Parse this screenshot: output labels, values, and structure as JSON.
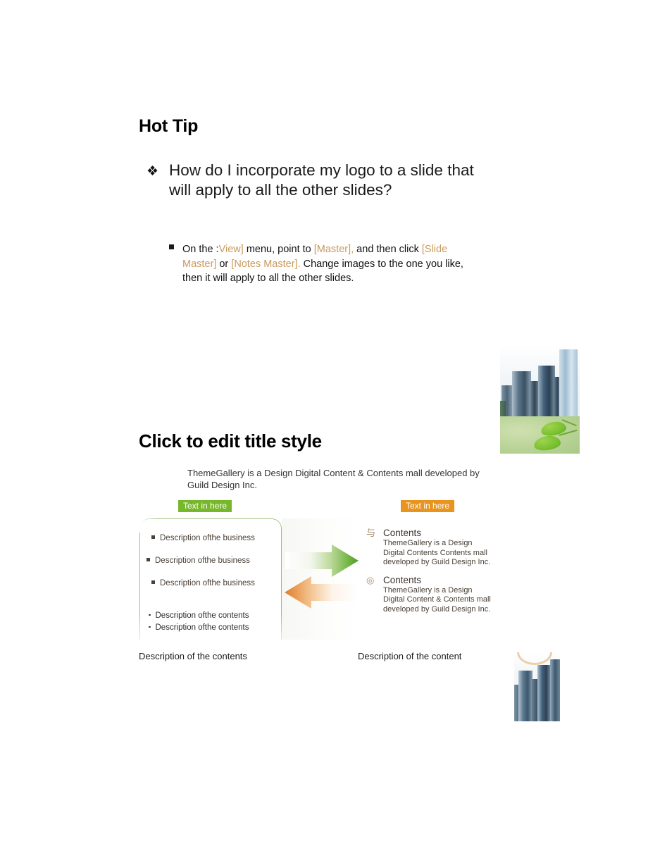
{
  "slide_hot_tip": {
    "title": "Hot Tip",
    "bullet_marker": "❖",
    "bullet_text": "How do I incorporate my logo to a slide that will apply to all the other slides?",
    "sub_bullet": {
      "marker": "square-bullet",
      "segments": [
        {
          "text": "On the :",
          "highlight": false
        },
        {
          "text": "View]",
          "highlight": true
        },
        {
          "text": " menu, point to ",
          "highlight": false
        },
        {
          "text": "[Master],",
          "highlight": true
        },
        {
          "text": " and then click ",
          "highlight": false
        },
        {
          "text": "[Slide Master]",
          "highlight": true
        },
        {
          "text": " or ",
          "highlight": false
        },
        {
          "text": "[Notes Master].",
          "highlight": true
        },
        {
          "text": " Change images to the one you like, then it will apply to all the other slides.",
          "highlight": false
        }
      ]
    }
  },
  "photo_city_leaf": {
    "alt": "skyscrapers-over-green-leaves-photo"
  },
  "photo_tower": {
    "alt": "blue-glass-skyscraper-photo"
  },
  "slide_contents": {
    "title": "Click to edit title style",
    "subtitle": "ThemeGallery is a Design Digital Content & Contents mall developed by Guild Design Inc.",
    "badge_left": "Text in here",
    "badge_right": "Text in here",
    "left_panel": {
      "business_items": [
        "Description ofthe business",
        "Description ofthe business",
        "Description ofthe business"
      ],
      "contents_items": [
        "Description ofthe contents",
        "Description ofthe contents"
      ]
    },
    "right_panel": {
      "blocks": [
        {
          "marker": "与",
          "heading": "Contents",
          "body": "ThemeGallery is a Design Digital Contents Contents mall developed by Guild Design Inc."
        },
        {
          "marker": "◎",
          "heading": "Contents",
          "body": "ThemeGallery is a Design Digital Content & Contents mall developed by Guild Design Inc."
        }
      ]
    },
    "caption_left": "Description of the contents",
    "caption_right": "Description of the content"
  },
  "colors": {
    "highlight_orange": "#c9995b",
    "badge_green": "#76b82a",
    "badge_orange": "#e8941e",
    "panel_border_green": "#9cc07e",
    "arrow_green": "#5aa832",
    "arrow_orange": "#e08a3c",
    "body_brown": "#4a4036"
  }
}
